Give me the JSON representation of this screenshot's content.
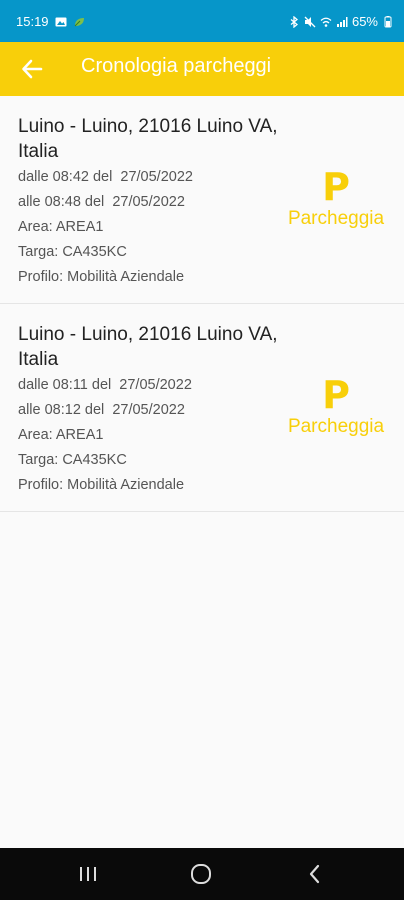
{
  "status_bar": {
    "time": "15:19",
    "battery": "65%",
    "left_icons": [
      "image-icon",
      "leaf-icon"
    ],
    "right_icons": [
      "bluetooth-icon",
      "mute-icon",
      "wifi-icon",
      "signal-icon",
      "battery-icon"
    ]
  },
  "app_bar": {
    "title": "Cronologia parcheggi",
    "back_icon": "arrow-left-icon"
  },
  "colors": {
    "status_bar": "#0696c9",
    "app_bar": "#f8cf0a",
    "accent": "#f8cf0a",
    "background": "#fafafa",
    "nav_bar": "#0a0a0a"
  },
  "parkings": [
    {
      "address": "Luino - Luino, 21016 Luino VA, Italia",
      "start": "dalle 08:42 del  27/05/2022",
      "end": "alle 08:48 del  27/05/2022",
      "area": "Area: AREA1",
      "plate": "Targa: CA435KC",
      "profile": "Profilo: Mobilità Aziendale",
      "action_letter": "P",
      "action_label": "Parcheggia"
    },
    {
      "address": "Luino - Luino, 21016 Luino VA, Italia",
      "start": "dalle 08:11 del  27/05/2022",
      "end": "alle 08:12 del  27/05/2022",
      "area": "Area: AREA1",
      "plate": "Targa: CA435KC",
      "profile": "Profilo: Mobilità Aziendale",
      "action_letter": "P",
      "action_label": "Parcheggia"
    }
  ],
  "nav_bar": {
    "buttons": [
      "recent-apps-icon",
      "home-icon",
      "back-icon"
    ]
  }
}
